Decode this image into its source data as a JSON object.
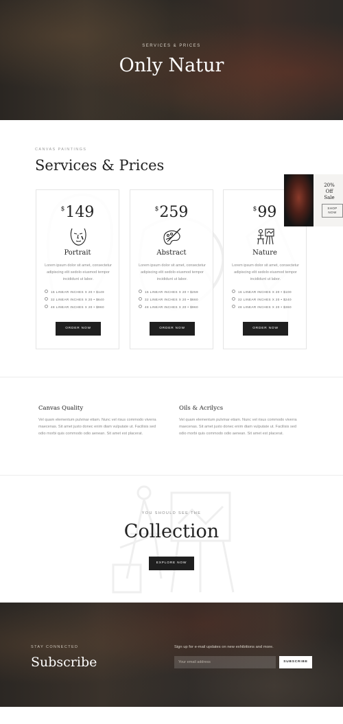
{
  "hero": {
    "eyebrow": "SERVICES & PRICES",
    "title": "Only Natur"
  },
  "services": {
    "eyebrow": "CANVAS PAINTINGS",
    "title": "Services & Prices",
    "cards": [
      {
        "currency": "$",
        "price": "149",
        "icon": "face-icon",
        "title": "Portrait",
        "desc": "Lorem ipsum dolor sit amet, consectetur adipiscing elit sedolo eiusmod tempor incididunt ut labor.",
        "options": [
          "16 LINEAR INCHES X 20 • $149",
          "32 LINEAR INCHES X 20 • $640",
          "48 LINEAR INCHES X 20 • $960"
        ],
        "button": "ORDER NOW"
      },
      {
        "currency": "$",
        "price": "259",
        "icon": "palette-icon",
        "title": "Abstract",
        "desc": "Lorem ipsum dolor sit amet, consectetur adipiscing elit sedolo eiusmod tempor incididunt ut labor.",
        "options": [
          "16 LINEAR INCHES X 20 • $259",
          "32 LINEAR INCHES X 20 • $660",
          "48 LINEAR INCHES X 20 • $960"
        ],
        "button": "ORDER NOW"
      },
      {
        "currency": "$",
        "price": "99",
        "icon": "easel-painter-icon",
        "title": "Nature",
        "desc": "Lorem ipsum dolor sit amet, consectetur adipiscing elit sedolo eiusmod tempor incididunt ut labor.",
        "options": [
          "16 LINEAR INCHES X 20 • $100",
          "32 LINEAR INCHES X 20 • $240",
          "48 LINEAR INCHES X 20 • $360"
        ],
        "button": "ORDER NOW"
      }
    ]
  },
  "sale": {
    "line1": "20%",
    "line2": "Off",
    "line3": "Sale",
    "shop_line1": "SHOP",
    "shop_line2": "NOW"
  },
  "info": [
    {
      "title": "Canvas Quality",
      "text": "Vel quam elementum pulvinar etiam. Nunc vel risus commodo viverra maecenas. Sit amet justo donec enim diam vulputate ut. Facilisis sed odio morbi quis commodo odio aenean. Sit amet est placerat."
    },
    {
      "title": "Oils & Acrilycs",
      "text": "Vel quam elementum pulvinar etiam. Nunc vel risus commodo viverra maecenas. Sit amet justo donec enim diam vulputate ut. Facilisis sed odio morbi quis commodo odio aenean. Sit amet est placerat."
    }
  ],
  "collection": {
    "eyebrow": "YOU SHOULD SEE THE",
    "title": "Collection",
    "button": "EXPLORE NOW"
  },
  "footer": {
    "eyebrow": "STAY CONNECTED",
    "title": "Subscribe",
    "note": "Sign up for e-mail updates on new exhibitions and more.",
    "email_placeholder": "Your email address",
    "button": "SUBSCRIBE"
  }
}
